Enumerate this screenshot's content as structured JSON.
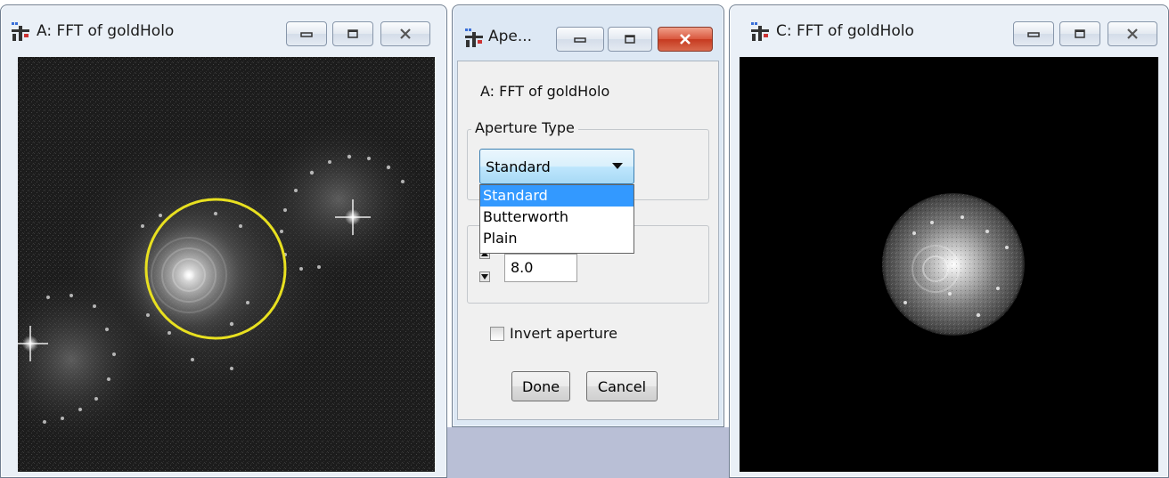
{
  "windows": {
    "left": {
      "title": "A: FFT of goldHolo"
    },
    "dialog": {
      "title": "Ape..."
    },
    "right": {
      "title": "C: FFT of goldHolo"
    }
  },
  "icons": {
    "app": "imagej-app-icon",
    "minimize": "minimize-icon",
    "maximize": "maximize-icon",
    "close": "close-icon"
  },
  "dialog": {
    "source_label": "A: FFT of goldHolo",
    "aperture_type": {
      "legend": "Aperture Type",
      "selected": "Standard",
      "options": [
        "Standard",
        "Butterworth",
        "Plain"
      ]
    },
    "radius_value": "8.0",
    "invert_label": "Invert aperture",
    "invert_checked": false,
    "done_label": "Done",
    "cancel_label": "Cancel"
  },
  "colors": {
    "aperture_circle": "#e8e020",
    "selection": "#3399ff",
    "close_button": "#c63a20"
  }
}
